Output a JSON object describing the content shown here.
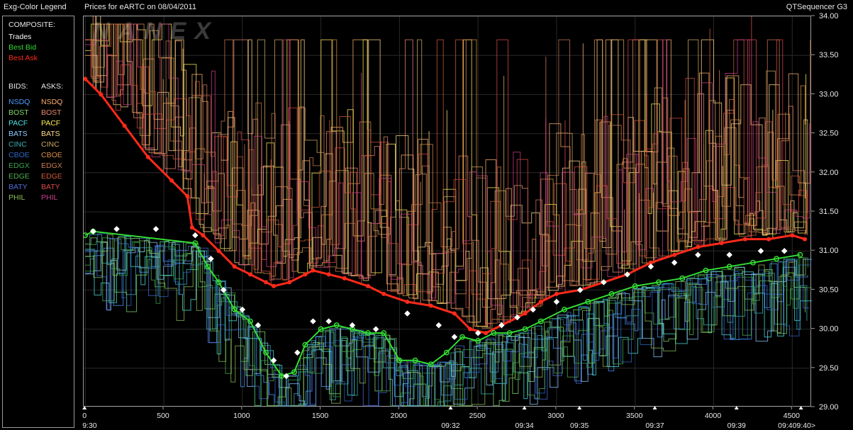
{
  "window": {
    "legend_title": "Exg-Color Legend",
    "chart_title": "Prices for  eARTC  on  08/04/2011",
    "app_name": "QTSequencer G3"
  },
  "legend": {
    "composite_header": "COMPOSITE:",
    "composite": [
      {
        "label": "Trades",
        "color": "#ffffff"
      },
      {
        "label": "Best Bid",
        "color": "#33dd33"
      },
      {
        "label": "Best Ask",
        "color": "#ff2a1a"
      }
    ],
    "bids_header": "BIDS:",
    "asks_header": "ASKS:",
    "bids": [
      {
        "label": "NSDQ",
        "color": "#4f9bff"
      },
      {
        "label": "BOST",
        "color": "#7fdc6a"
      },
      {
        "label": "PACF",
        "color": "#4fe3e3"
      },
      {
        "label": "BATS",
        "color": "#8ecbff"
      },
      {
        "label": "CINC",
        "color": "#3bb0b8"
      },
      {
        "label": "CBOE",
        "color": "#2f66c8"
      },
      {
        "label": "EDGX",
        "color": "#3aa34a"
      },
      {
        "label": "EDGE",
        "color": "#50b050"
      },
      {
        "label": "BATY",
        "color": "#4d6cd9"
      },
      {
        "label": "PHIL",
        "color": "#8fbf5a"
      }
    ],
    "asks": [
      {
        "label": "NSDQ",
        "color": "#ffb070"
      },
      {
        "label": "BOST",
        "color": "#e88a70"
      },
      {
        "label": "PACF",
        "color": "#ffee5a"
      },
      {
        "label": "BATS",
        "color": "#ffd98a"
      },
      {
        "label": "CINC",
        "color": "#cfa860"
      },
      {
        "label": "CBOE",
        "color": "#d8904a"
      },
      {
        "label": "EDGX",
        "color": "#c87a50"
      },
      {
        "label": "EDGE",
        "color": "#d05a3a"
      },
      {
        "label": "BATY",
        "color": "#d84a4a"
      },
      {
        "label": "PHIL",
        "color": "#c8408a"
      }
    ]
  },
  "watermark": "NANEX",
  "chart_data": {
    "type": "line",
    "x_ticks": [
      0,
      500,
      1000,
      1500,
      2000,
      2500,
      3000,
      3500,
      4000,
      4500
    ],
    "time_ticks": [
      {
        "seq": 0,
        "label": "9:30"
      },
      {
        "seq": 2330,
        "label": "09:32"
      },
      {
        "seq": 2800,
        "label": "09:34"
      },
      {
        "seq": 3150,
        "label": "09:35"
      },
      {
        "seq": 3630,
        "label": "09:37"
      },
      {
        "seq": 4150,
        "label": "09:39"
      },
      {
        "seq": 4560,
        "label": "09:409:40>"
      }
    ],
    "y_ticks": [
      29.0,
      29.5,
      30.0,
      30.5,
      31.0,
      31.5,
      32.0,
      32.5,
      33.0,
      33.5,
      34.0
    ],
    "xlim": [
      -10,
      4625
    ],
    "ylim": [
      29.0,
      34.0
    ],
    "grid": true,
    "series": [
      {
        "name": "Best Ask",
        "color": "#ff2a1a",
        "points": [
          [
            0,
            33.2
          ],
          [
            100,
            33.0
          ],
          [
            250,
            32.6
          ],
          [
            400,
            32.2
          ],
          [
            550,
            31.9
          ],
          [
            650,
            31.7
          ],
          [
            680,
            31.3
          ],
          [
            750,
            31.2
          ],
          [
            850,
            31.0
          ],
          [
            950,
            30.8
          ],
          [
            1050,
            30.7
          ],
          [
            1150,
            30.6
          ],
          [
            1200,
            30.55
          ],
          [
            1300,
            30.6
          ],
          [
            1400,
            30.7
          ],
          [
            1450,
            30.75
          ],
          [
            1550,
            30.7
          ],
          [
            1650,
            30.65
          ],
          [
            1800,
            30.55
          ],
          [
            1900,
            30.45
          ],
          [
            2050,
            30.35
          ],
          [
            2200,
            30.3
          ],
          [
            2350,
            30.2
          ],
          [
            2450,
            30.0
          ],
          [
            2550,
            29.95
          ],
          [
            2650,
            30.05
          ],
          [
            2800,
            30.2
          ],
          [
            2900,
            30.35
          ],
          [
            3000,
            30.45
          ],
          [
            3150,
            30.5
          ],
          [
            3300,
            30.6
          ],
          [
            3450,
            30.7
          ],
          [
            3600,
            30.85
          ],
          [
            3750,
            30.95
          ],
          [
            3900,
            31.05
          ],
          [
            4050,
            31.1
          ],
          [
            4200,
            31.15
          ],
          [
            4350,
            31.15
          ],
          [
            4500,
            31.2
          ],
          [
            4580,
            31.15
          ]
        ]
      },
      {
        "name": "Best Bid",
        "color": "#33dd33",
        "points": [
          [
            0,
            31.2
          ],
          [
            50,
            31.25
          ],
          [
            700,
            31.1
          ],
          [
            780,
            30.8
          ],
          [
            850,
            30.6
          ],
          [
            950,
            30.25
          ],
          [
            1050,
            30.1
          ],
          [
            1150,
            29.7
          ],
          [
            1250,
            29.4
          ],
          [
            1330,
            29.45
          ],
          [
            1400,
            29.8
          ],
          [
            1500,
            30.0
          ],
          [
            1600,
            30.05
          ],
          [
            1700,
            30.0
          ],
          [
            1800,
            29.95
          ],
          [
            1900,
            29.95
          ],
          [
            2000,
            29.6
          ],
          [
            2100,
            29.6
          ],
          [
            2200,
            29.55
          ],
          [
            2300,
            29.7
          ],
          [
            2400,
            29.9
          ],
          [
            2500,
            29.85
          ],
          [
            2600,
            29.95
          ],
          [
            2700,
            29.95
          ],
          [
            2800,
            30.0
          ],
          [
            2900,
            30.1
          ],
          [
            3050,
            30.25
          ],
          [
            3200,
            30.35
          ],
          [
            3350,
            30.45
          ],
          [
            3500,
            30.55
          ],
          [
            3650,
            30.6
          ],
          [
            3800,
            30.65
          ],
          [
            3950,
            30.75
          ],
          [
            4100,
            30.8
          ],
          [
            4250,
            30.85
          ],
          [
            4400,
            30.9
          ],
          [
            4550,
            30.95
          ]
        ]
      },
      {
        "name": "Trades",
        "color": "#ffffff",
        "points": [
          [
            50,
            31.25
          ],
          [
            200,
            31.28
          ],
          [
            450,
            31.28
          ],
          [
            700,
            31.2
          ],
          [
            800,
            30.9
          ],
          [
            880,
            30.5
          ],
          [
            1000,
            30.25
          ],
          [
            1100,
            30.05
          ],
          [
            1200,
            29.6
          ],
          [
            1280,
            29.4
          ],
          [
            1350,
            29.7
          ],
          [
            1450,
            30.1
          ],
          [
            1550,
            30.1
          ],
          [
            1700,
            30.05
          ],
          [
            1850,
            30.0
          ],
          [
            2050,
            30.2
          ],
          [
            2250,
            30.05
          ],
          [
            2350,
            29.9
          ],
          [
            2500,
            29.95
          ],
          [
            2650,
            30.05
          ],
          [
            2750,
            30.15
          ],
          [
            2850,
            30.25
          ],
          [
            3000,
            30.35
          ],
          [
            3150,
            30.5
          ],
          [
            3300,
            30.6
          ],
          [
            3450,
            30.7
          ],
          [
            3600,
            30.8
          ],
          [
            3750,
            30.85
          ],
          [
            3900,
            30.95
          ],
          [
            4100,
            30.95
          ],
          [
            4300,
            31.0
          ],
          [
            4450,
            31.0
          ]
        ]
      }
    ]
  }
}
